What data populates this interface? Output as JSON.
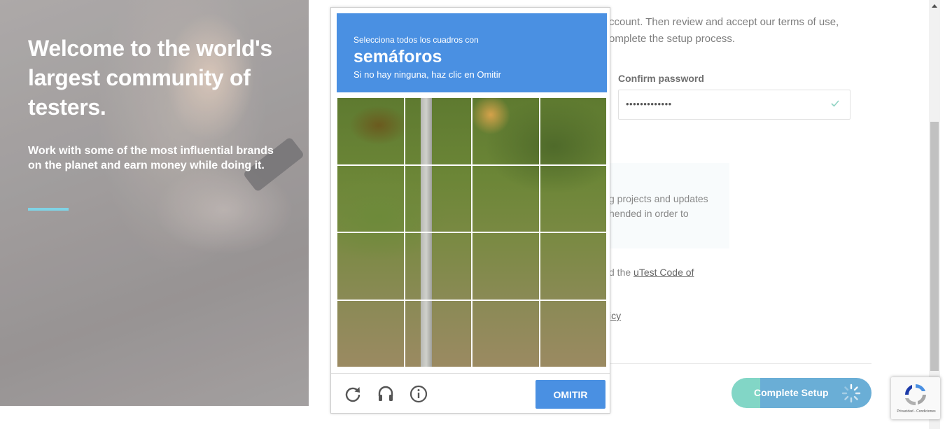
{
  "hero": {
    "title": "Welcome to the world's largest community of testers.",
    "subtitle": "Work with some of the most influential brands on the planet and earn money while doing it."
  },
  "form": {
    "intro_line1": "ccount. Then review and accept our terms of use,",
    "intro_line2": "omplete the setup process.",
    "confirm_password_label": "Confirm password",
    "confirm_password_value": "•••••••••••••",
    "info_text": "g projects and updates hended in order to",
    "terms_prefix": "d the ",
    "terms_link": "uTest Code of",
    "privacy_link": "icy",
    "complete_setup_label": "Complete Setup"
  },
  "captcha": {
    "instruction": "Selecciona todos los cuadros con",
    "target": "semáforos",
    "sub": "Si no hay ninguna, haz clic en Omitir",
    "skip_label": "OMITIR",
    "tiles": 16
  },
  "recaptcha_badge": {
    "legal": "Privacidad - Condiciones"
  },
  "colors": {
    "captcha_blue": "#4a90e2",
    "accent_teal": "#82d6c6",
    "button_blue": "#6aaed6",
    "hero_rule": "#7fd3e6"
  }
}
